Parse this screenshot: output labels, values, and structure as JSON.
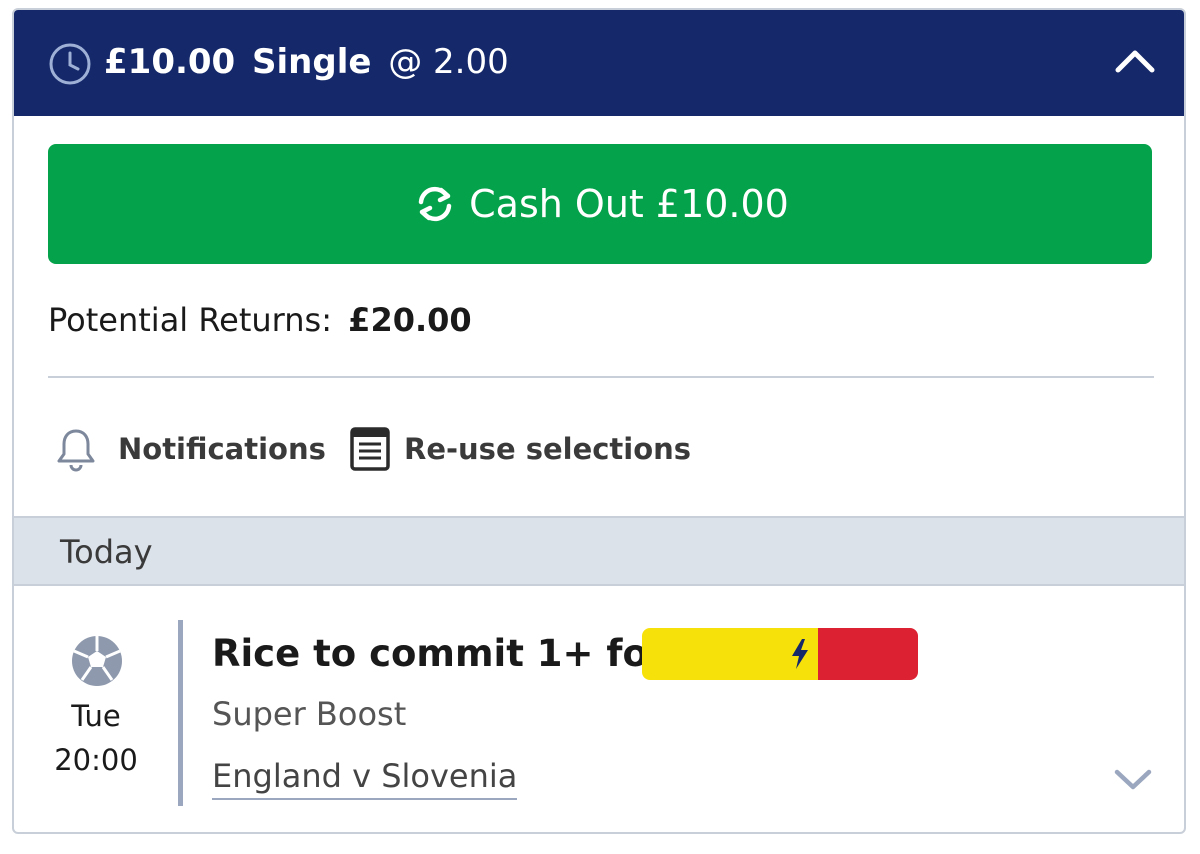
{
  "bet_header": {
    "stake": "£10.00",
    "bet_type": "Single",
    "odds": "@ 2.00",
    "status_icon": "clock-icon",
    "collapse_icon": "chevron-up-icon"
  },
  "cash_out": {
    "label": "Cash Out £10.00",
    "icon": "cash-out-refresh-icon",
    "color": "#04a24a"
  },
  "potential_returns": {
    "label": "Potential Returns:",
    "amount": "£20.00"
  },
  "actions": {
    "notifications": {
      "label": "Notifications",
      "icon": "bell-icon"
    },
    "reuse": {
      "label": "Re-use selections",
      "icon": "document-list-icon"
    }
  },
  "date_group": {
    "label": "Today"
  },
  "selection": {
    "sport_icon": "football-icon",
    "day": "Tue",
    "time": "20:00",
    "name": "Rice to commit 1+ foul",
    "boost_badge": {
      "icon": "lightning-bolt-icon",
      "colors": [
        "#f7e10a",
        "#dc2133"
      ]
    },
    "market": "Super Boost",
    "event": "England v Slovenia",
    "expand_icon": "chevron-down-icon"
  },
  "colors": {
    "header_bg": "#14286a",
    "date_bar_bg": "#dce2ea",
    "divider": "#c9cfd8"
  }
}
